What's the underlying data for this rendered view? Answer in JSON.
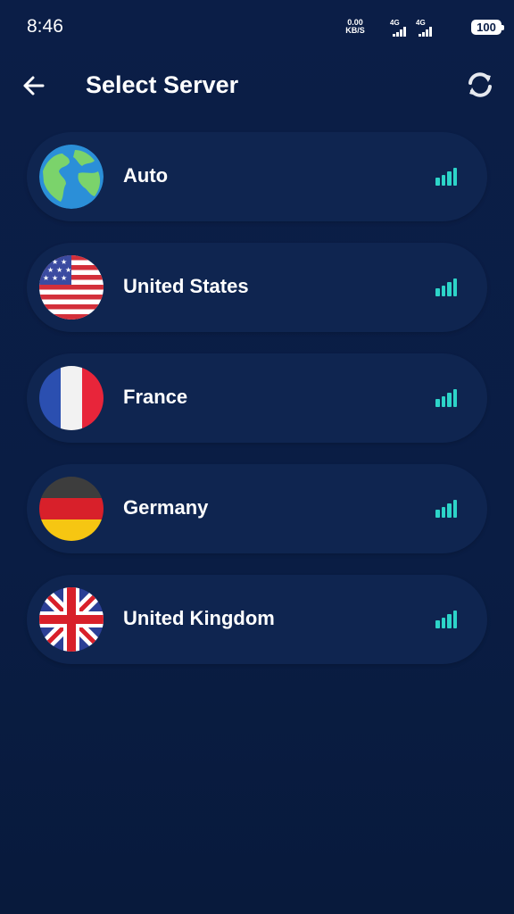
{
  "status_bar": {
    "time": "8:46",
    "net_speed_value": "0.00",
    "net_speed_unit": "KB/S",
    "sim1_label": "4G",
    "sim2_label": "4G",
    "battery_level": "100"
  },
  "header": {
    "back_icon": "arrow-left-icon",
    "title": "Select Server",
    "refresh_icon": "refresh-icon"
  },
  "colors": {
    "background": "#0b1e47",
    "card": "#0f2550",
    "signal_accent": "#2dd4c8",
    "text": "#ffffff"
  },
  "servers": [
    {
      "name": "Auto",
      "flag_icon": "globe-icon",
      "signal_bars": 4
    },
    {
      "name": "United States",
      "flag_icon": "us-flag-icon",
      "signal_bars": 4
    },
    {
      "name": "France",
      "flag_icon": "france-flag-icon",
      "signal_bars": 4
    },
    {
      "name": "Germany",
      "flag_icon": "germany-flag-icon",
      "signal_bars": 4
    },
    {
      "name": "United Kingdom",
      "flag_icon": "uk-flag-icon",
      "signal_bars": 4
    }
  ]
}
